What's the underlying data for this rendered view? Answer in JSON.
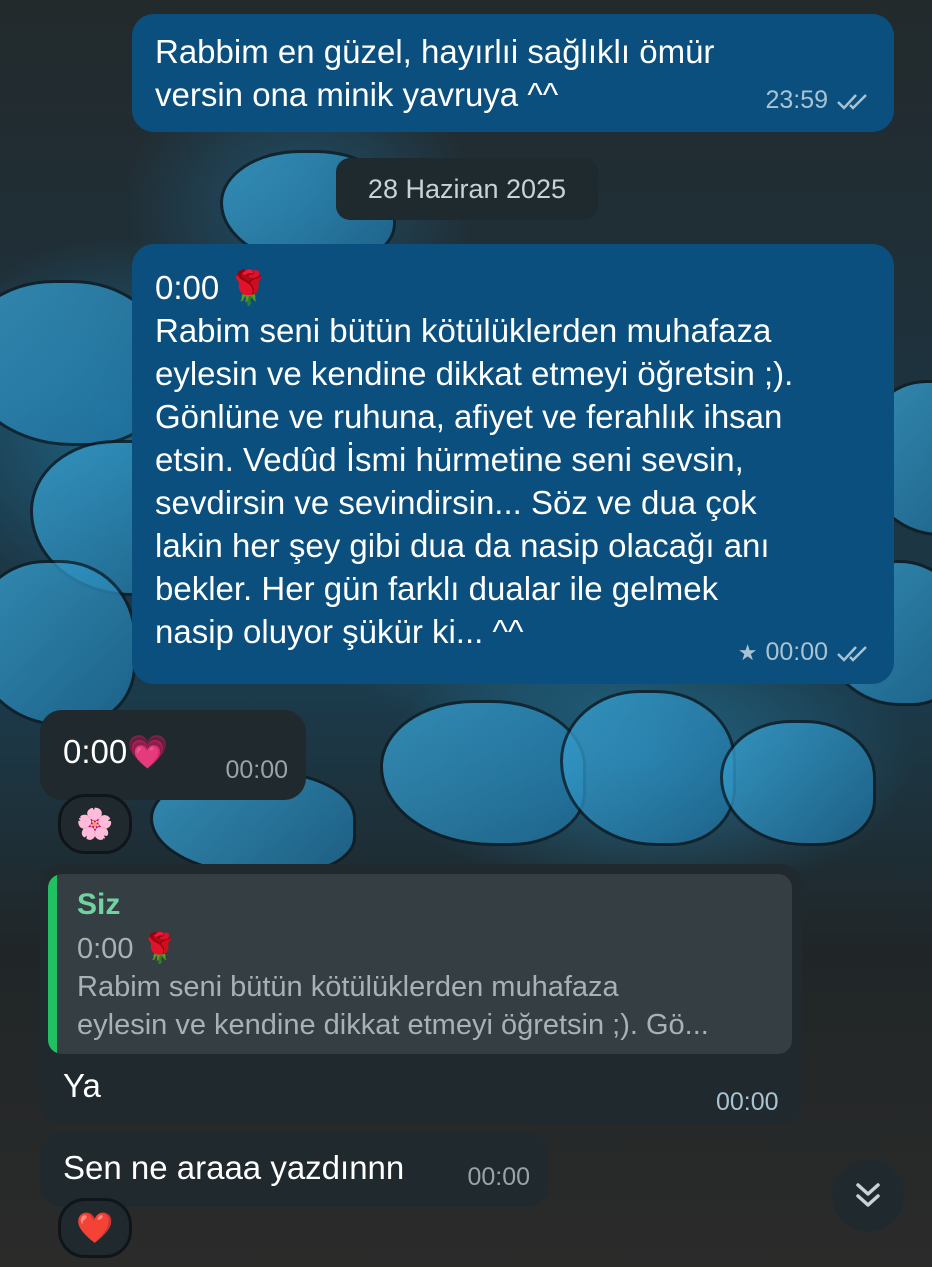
{
  "chat": {
    "messages": [
      {
        "direction": "outgoing",
        "lines": [
          "Rabbim en güzel, hayırlıi sağlıklı ömür",
          "versin ona minik yavruya ^^"
        ],
        "time": "23:59",
        "status": "read"
      },
      {
        "direction": "outgoing",
        "lines": [
          "0:00 🌹",
          "Rabim seni bütün kötülüklerden muhafaza",
          "eylesin ve kendine dikkat etmeyi öğretsin ;).",
          "Gönlüne ve ruhuna, afiyet ve ferahlık ihsan",
          "etsin. Vedûd İsmi hürmetine seni sevsin,",
          "sevdirsin ve sevindirsin... Söz ve dua çok",
          "lakin her şey gibi dua da nasip olacağı anı",
          "bekler. Her gün farklı dualar ile gelmek",
          "nasip oluyor şükür ki... ^^"
        ],
        "time": "00:00",
        "starred": true,
        "status": "read"
      },
      {
        "direction": "incoming",
        "text": "0:00💗",
        "time": "00:00",
        "reaction": "🌸"
      },
      {
        "direction": "incoming",
        "reply_to": {
          "author": "Siz",
          "lines": [
            "0:00 🌹",
            "Rabim seni bütün kötülüklerden muhafaza",
            "eylesin ve kendine dikkat etmeyi öğretsin ;).  Gö..."
          ]
        },
        "text": "Ya",
        "time": "00:00"
      },
      {
        "direction": "incoming",
        "text": "Sen ne araaa yazdınnn",
        "time": "00:00",
        "reaction": "❤️"
      }
    ],
    "date_separator": "28 Haziran 2025",
    "scroll_button_icon": "chevron-double-down-icon",
    "colors": {
      "outgoing_bubble": "#0b4f7e",
      "incoming_bubble": "#20292d",
      "quote_bar": "#21c063",
      "quote_author": "#71d4a0"
    }
  }
}
